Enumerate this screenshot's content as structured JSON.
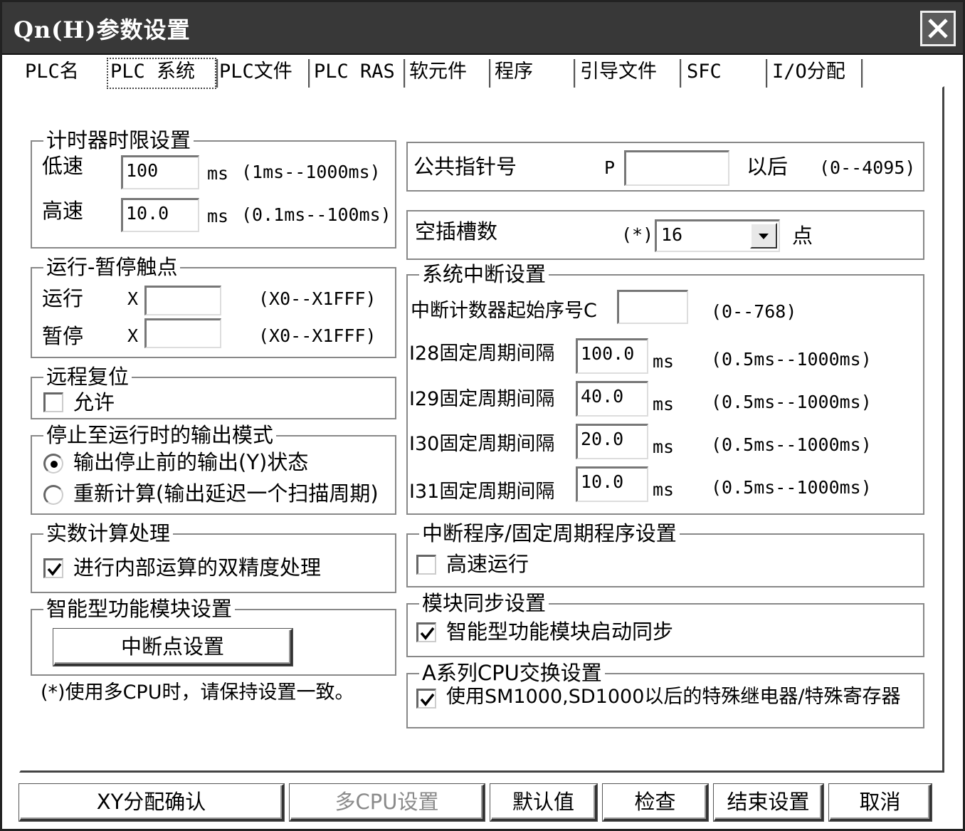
{
  "window": {
    "title": "Qn(H)参数设置",
    "close_label": "✕"
  },
  "tabs": [
    {
      "label": "PLC名"
    },
    {
      "label": "PLC 系统"
    },
    {
      "label": "PLC文件"
    },
    {
      "label": "PLC RAS"
    },
    {
      "label": "软元件"
    },
    {
      "label": "程序"
    },
    {
      "label": "引导文件"
    },
    {
      "label": "SFC"
    },
    {
      "label": "I/O分配"
    }
  ],
  "timer": {
    "title": "计时器时限设置",
    "low_label": "低速",
    "low_value": "100",
    "low_unit": "ms",
    "low_range": "(1ms--1000ms)",
    "high_label": "高速",
    "high_value": "10.0",
    "high_unit": "ms",
    "high_range": "(0.1ms--100ms)"
  },
  "run_pause": {
    "title": "运行-暂停触点",
    "run_label": "运行",
    "run_prefix": "X",
    "run_value": "",
    "run_range": "(X0--X1FFF)",
    "pause_label": "暂停",
    "pause_prefix": "X",
    "pause_value": "",
    "pause_range": "(X0--X1FFF)"
  },
  "remote_reset": {
    "title": "远程复位",
    "allow_label": "允许",
    "allow_checked": false
  },
  "output_mode": {
    "title": "停止至运行时的输出模式",
    "opt1": "输出停止前的输出(Y)状态",
    "opt2": "重新计算(输出延迟一个扫描周期)",
    "selected": 1
  },
  "float_calc": {
    "title": "实数计算处理",
    "double_label": "进行内部运算的双精度处理",
    "double_checked": true
  },
  "intelligent": {
    "title": "智能型功能模块设置",
    "interrupt_button": "中断点设置"
  },
  "footnote": "(*)使用多CPU时，请保持设置一致。",
  "common_pointer": {
    "label": "公共指针号",
    "prefix": "P",
    "value": "",
    "suffix": "以后",
    "range": "(0--4095)"
  },
  "empty_slots": {
    "label": "空插槽数",
    "star": "(*)",
    "value": "16",
    "unit": "点"
  },
  "sys_interrupt": {
    "title": "系统中断设置",
    "counter_label": "中断计数器起始序号C",
    "counter_value": "",
    "counter_range": "(0--768)",
    "rows": [
      {
        "label": "I28固定周期间隔",
        "value": "100.0",
        "unit": "ms",
        "range": "(0.5ms--1000ms)"
      },
      {
        "label": "I29固定周期间隔",
        "value": "40.0",
        "unit": "ms",
        "range": "(0.5ms--1000ms)"
      },
      {
        "label": "I30固定周期间隔",
        "value": "20.0",
        "unit": "ms",
        "range": "(0.5ms--1000ms)"
      },
      {
        "label": "I31固定周期间隔",
        "value": "10.0",
        "unit": "ms",
        "range": "(0.5ms--1000ms)"
      }
    ]
  },
  "interrupt_prog": {
    "title": "中断程序/固定周期程序设置",
    "highspeed_label": "高速运行",
    "highspeed_checked": false
  },
  "module_sync": {
    "title": "模块同步设置",
    "sync_label": "智能型功能模块启动同步",
    "sync_checked": true
  },
  "a_series": {
    "title": "A系列CPU交换设置",
    "use_label": "使用SM1000,SD1000以后的特殊继电器/特殊寄存器",
    "use_checked": true
  },
  "buttons": {
    "xy": "XY分配确认",
    "multi_cpu": "多CPU设置",
    "default": "默认值",
    "check": "检查",
    "finish": "结束设置",
    "cancel": "取消"
  }
}
